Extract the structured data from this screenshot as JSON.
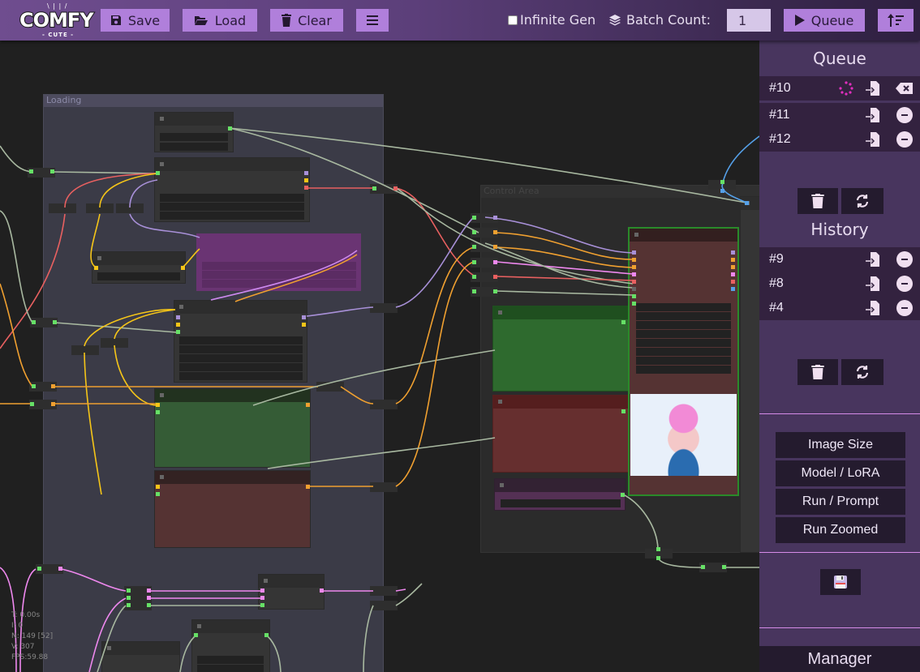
{
  "app": {
    "logo_text": "COMFY",
    "logo_subtext": "- CUTE -"
  },
  "toolbar": {
    "save_label": "Save",
    "load_label": "Load",
    "clear_label": "Clear",
    "menu_icon": "hamburger-icon",
    "infinite_gen_label": "Infinite Gen",
    "infinite_gen_checked": false,
    "batch_count_label": "Batch Count:",
    "batch_count_value": "1",
    "queue_label": "Queue",
    "sort_icon": "sort-icon"
  },
  "canvas": {
    "groups": [
      {
        "title": "Loading"
      },
      {
        "title": "Control Area"
      }
    ],
    "stats": [
      "T: 0.00s",
      "I: 0",
      "N: 149 [52]",
      "V: 307",
      "FPS:59.88"
    ],
    "colors": {
      "background": "#202020",
      "link_clip": "#f5c518",
      "link_model": "#a890d8",
      "link_vae": "#e86060",
      "link_latent": "#ee88ee",
      "link_conditioning": "#f0a030",
      "link_image": "#66e066",
      "link_int": "#55a0e8"
    }
  },
  "sidebar": {
    "queue_title": "Queue",
    "queue_items": [
      {
        "label": "#10",
        "status": "running"
      },
      {
        "label": "#11",
        "status": "pending"
      },
      {
        "label": "#12",
        "status": "pending"
      }
    ],
    "history_title": "History",
    "history_items": [
      {
        "label": "#9"
      },
      {
        "label": "#8"
      },
      {
        "label": "#4"
      }
    ],
    "presets": [
      "Image Size",
      "Model / LoRA",
      "Run / Prompt",
      "Run Zoomed"
    ],
    "manager_label": "Manager",
    "accent": "#d58be8"
  }
}
